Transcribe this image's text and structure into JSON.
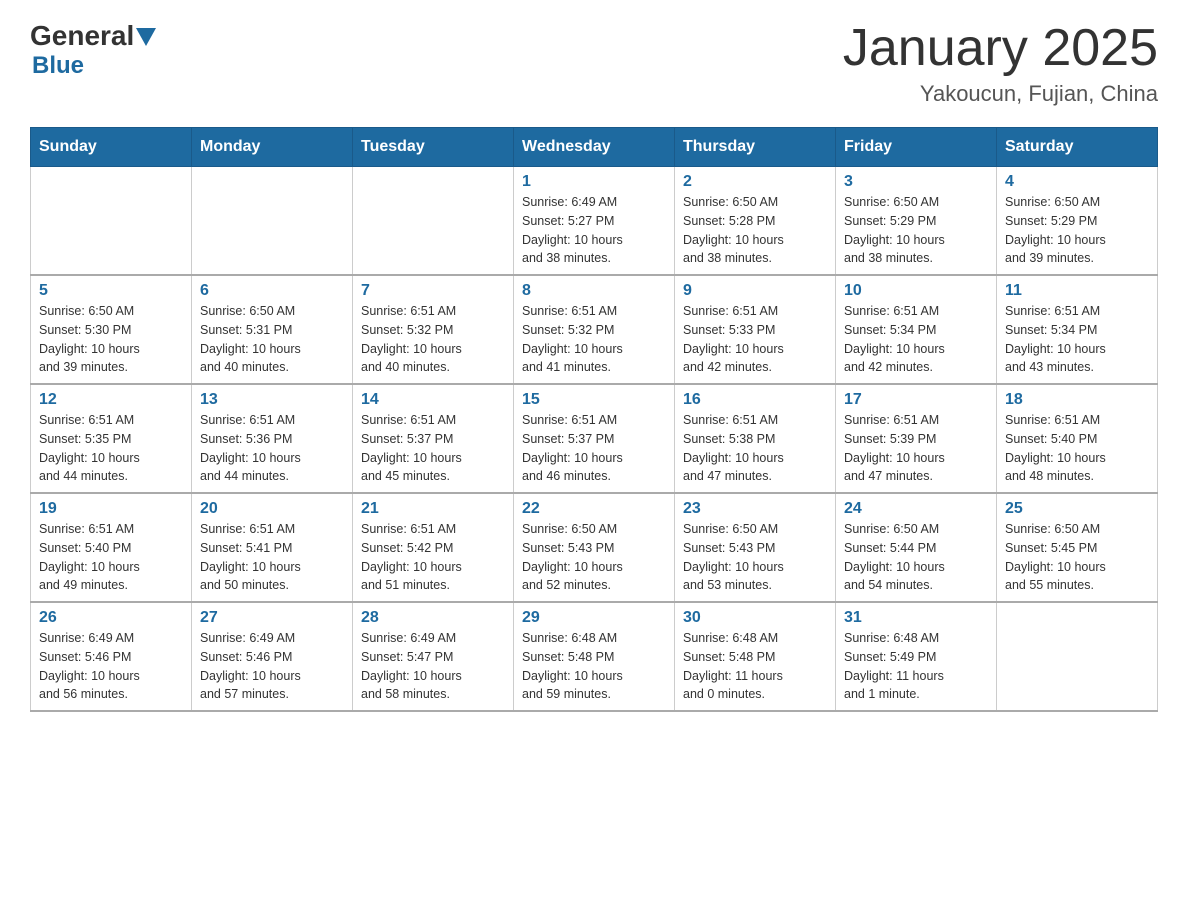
{
  "header": {
    "logo_general": "General",
    "logo_blue": "Blue",
    "title": "January 2025",
    "subtitle": "Yakoucun, Fujian, China"
  },
  "weekdays": [
    "Sunday",
    "Monday",
    "Tuesday",
    "Wednesday",
    "Thursday",
    "Friday",
    "Saturday"
  ],
  "weeks": [
    [
      {
        "day": "",
        "info": ""
      },
      {
        "day": "",
        "info": ""
      },
      {
        "day": "",
        "info": ""
      },
      {
        "day": "1",
        "info": "Sunrise: 6:49 AM\nSunset: 5:27 PM\nDaylight: 10 hours\nand 38 minutes."
      },
      {
        "day": "2",
        "info": "Sunrise: 6:50 AM\nSunset: 5:28 PM\nDaylight: 10 hours\nand 38 minutes."
      },
      {
        "day": "3",
        "info": "Sunrise: 6:50 AM\nSunset: 5:29 PM\nDaylight: 10 hours\nand 38 minutes."
      },
      {
        "day": "4",
        "info": "Sunrise: 6:50 AM\nSunset: 5:29 PM\nDaylight: 10 hours\nand 39 minutes."
      }
    ],
    [
      {
        "day": "5",
        "info": "Sunrise: 6:50 AM\nSunset: 5:30 PM\nDaylight: 10 hours\nand 39 minutes."
      },
      {
        "day": "6",
        "info": "Sunrise: 6:50 AM\nSunset: 5:31 PM\nDaylight: 10 hours\nand 40 minutes."
      },
      {
        "day": "7",
        "info": "Sunrise: 6:51 AM\nSunset: 5:32 PM\nDaylight: 10 hours\nand 40 minutes."
      },
      {
        "day": "8",
        "info": "Sunrise: 6:51 AM\nSunset: 5:32 PM\nDaylight: 10 hours\nand 41 minutes."
      },
      {
        "day": "9",
        "info": "Sunrise: 6:51 AM\nSunset: 5:33 PM\nDaylight: 10 hours\nand 42 minutes."
      },
      {
        "day": "10",
        "info": "Sunrise: 6:51 AM\nSunset: 5:34 PM\nDaylight: 10 hours\nand 42 minutes."
      },
      {
        "day": "11",
        "info": "Sunrise: 6:51 AM\nSunset: 5:34 PM\nDaylight: 10 hours\nand 43 minutes."
      }
    ],
    [
      {
        "day": "12",
        "info": "Sunrise: 6:51 AM\nSunset: 5:35 PM\nDaylight: 10 hours\nand 44 minutes."
      },
      {
        "day": "13",
        "info": "Sunrise: 6:51 AM\nSunset: 5:36 PM\nDaylight: 10 hours\nand 44 minutes."
      },
      {
        "day": "14",
        "info": "Sunrise: 6:51 AM\nSunset: 5:37 PM\nDaylight: 10 hours\nand 45 minutes."
      },
      {
        "day": "15",
        "info": "Sunrise: 6:51 AM\nSunset: 5:37 PM\nDaylight: 10 hours\nand 46 minutes."
      },
      {
        "day": "16",
        "info": "Sunrise: 6:51 AM\nSunset: 5:38 PM\nDaylight: 10 hours\nand 47 minutes."
      },
      {
        "day": "17",
        "info": "Sunrise: 6:51 AM\nSunset: 5:39 PM\nDaylight: 10 hours\nand 47 minutes."
      },
      {
        "day": "18",
        "info": "Sunrise: 6:51 AM\nSunset: 5:40 PM\nDaylight: 10 hours\nand 48 minutes."
      }
    ],
    [
      {
        "day": "19",
        "info": "Sunrise: 6:51 AM\nSunset: 5:40 PM\nDaylight: 10 hours\nand 49 minutes."
      },
      {
        "day": "20",
        "info": "Sunrise: 6:51 AM\nSunset: 5:41 PM\nDaylight: 10 hours\nand 50 minutes."
      },
      {
        "day": "21",
        "info": "Sunrise: 6:51 AM\nSunset: 5:42 PM\nDaylight: 10 hours\nand 51 minutes."
      },
      {
        "day": "22",
        "info": "Sunrise: 6:50 AM\nSunset: 5:43 PM\nDaylight: 10 hours\nand 52 minutes."
      },
      {
        "day": "23",
        "info": "Sunrise: 6:50 AM\nSunset: 5:43 PM\nDaylight: 10 hours\nand 53 minutes."
      },
      {
        "day": "24",
        "info": "Sunrise: 6:50 AM\nSunset: 5:44 PM\nDaylight: 10 hours\nand 54 minutes."
      },
      {
        "day": "25",
        "info": "Sunrise: 6:50 AM\nSunset: 5:45 PM\nDaylight: 10 hours\nand 55 minutes."
      }
    ],
    [
      {
        "day": "26",
        "info": "Sunrise: 6:49 AM\nSunset: 5:46 PM\nDaylight: 10 hours\nand 56 minutes."
      },
      {
        "day": "27",
        "info": "Sunrise: 6:49 AM\nSunset: 5:46 PM\nDaylight: 10 hours\nand 57 minutes."
      },
      {
        "day": "28",
        "info": "Sunrise: 6:49 AM\nSunset: 5:47 PM\nDaylight: 10 hours\nand 58 minutes."
      },
      {
        "day": "29",
        "info": "Sunrise: 6:48 AM\nSunset: 5:48 PM\nDaylight: 10 hours\nand 59 minutes."
      },
      {
        "day": "30",
        "info": "Sunrise: 6:48 AM\nSunset: 5:48 PM\nDaylight: 11 hours\nand 0 minutes."
      },
      {
        "day": "31",
        "info": "Sunrise: 6:48 AM\nSunset: 5:49 PM\nDaylight: 11 hours\nand 1 minute."
      },
      {
        "day": "",
        "info": ""
      }
    ]
  ]
}
